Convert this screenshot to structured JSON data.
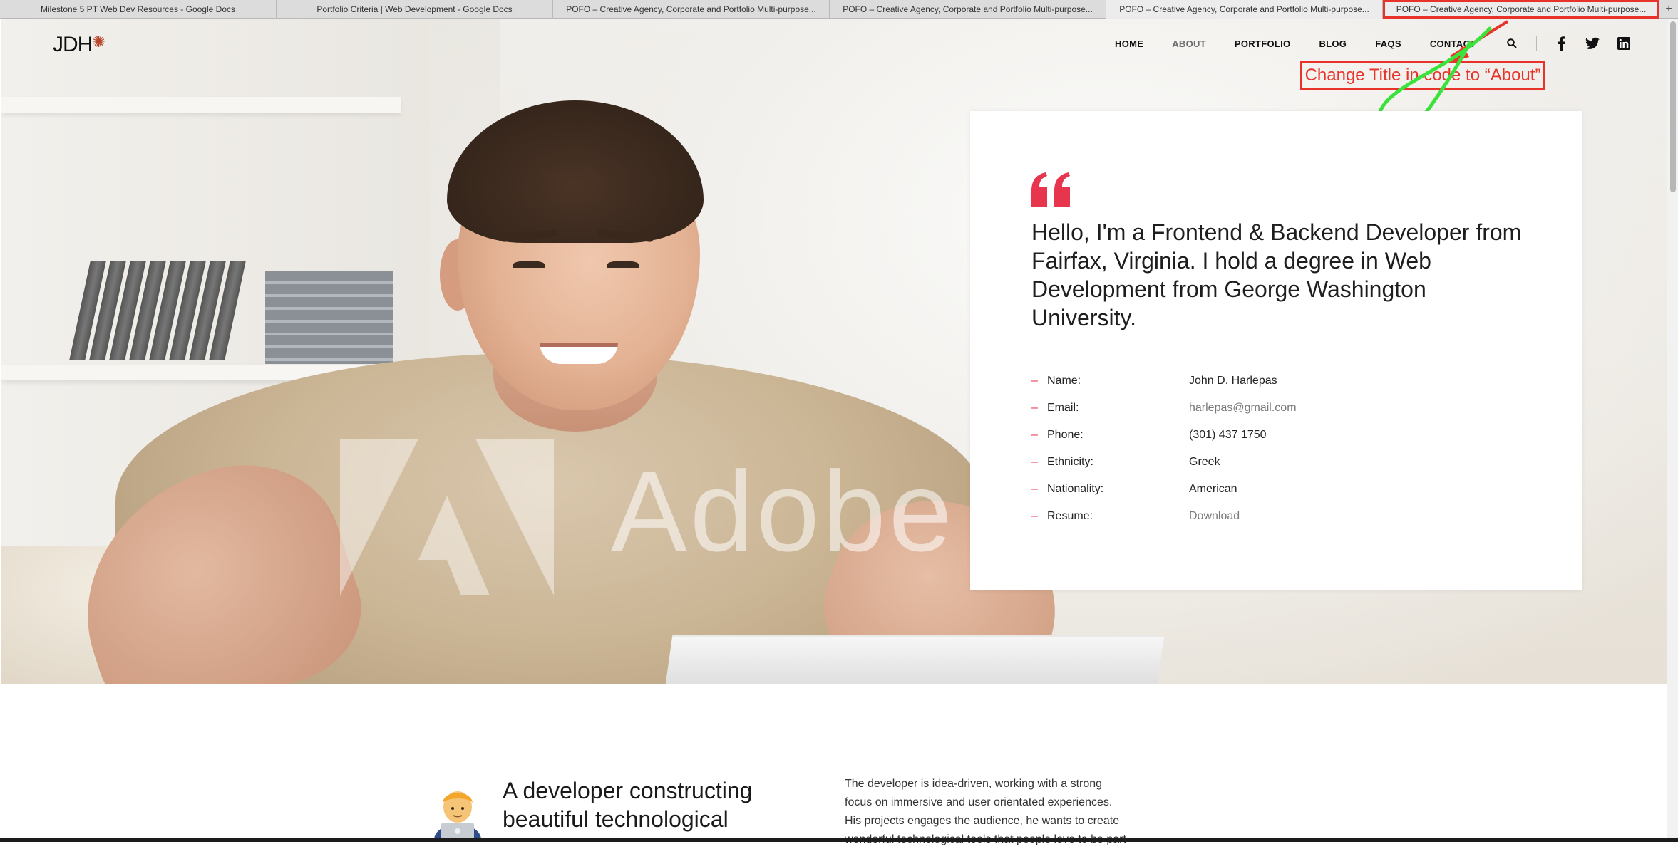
{
  "browser": {
    "tabs": [
      {
        "title": "Milestone 5 PT Web Dev Resources - Google Docs"
      },
      {
        "title": "Portfolio Criteria | Web Development - Google Docs"
      },
      {
        "title": "POFO – Creative Agency, Corporate and Portfolio Multi-purpose..."
      },
      {
        "title": "POFO – Creative Agency, Corporate and Portfolio Multi-purpose..."
      },
      {
        "title": "POFO – Creative Agency, Corporate and Portfolio Multi-purpose..."
      },
      {
        "title": "POFO – Creative Agency, Corporate and Portfolio Multi-purpose..."
      }
    ],
    "new_tab": "+"
  },
  "header": {
    "logo": "JDH",
    "logo_mark": "✺",
    "nav": [
      {
        "label": "HOME",
        "active": false
      },
      {
        "label": "ABOUT",
        "active": true
      },
      {
        "label": "PORTFOLIO",
        "active": false
      },
      {
        "label": "BLOG",
        "active": false
      },
      {
        "label": "FAQS",
        "active": false
      },
      {
        "label": "CONTACT",
        "active": false
      }
    ],
    "icons": [
      "search-icon",
      "facebook-icon",
      "twitter-icon",
      "linkedin-icon"
    ]
  },
  "annotation": {
    "note": "Change Title in code to “About”",
    "color": "#e8332a",
    "stroke_color": "#3be23b"
  },
  "hero": {
    "watermark_text": "Adobe"
  },
  "card": {
    "accent": "#e8354e",
    "headline": "Hello, I'm a Frontend & Backend Developer from Fairfax, Virginia. I hold a degree in Web Development from George Washington University.",
    "facts": [
      {
        "label": "Name:",
        "value": "John D. Harlepas"
      },
      {
        "label": "Email:",
        "value": "harlepas@gmail.com"
      },
      {
        "label": "Phone:",
        "value": "(301) 437 1750"
      },
      {
        "label": "Ethnicity:",
        "value": "Greek"
      },
      {
        "label": "Nationality:",
        "value": "American"
      },
      {
        "label": "Resume:",
        "value": "Download"
      }
    ]
  },
  "section2": {
    "title": "A developer constructing beautiful technological",
    "body": "The developer is idea-driven, working with a strong focus on immersive and user orientated experiences. His projects engages the audience, he wants to create wonderful technological tools that people love to be part"
  }
}
